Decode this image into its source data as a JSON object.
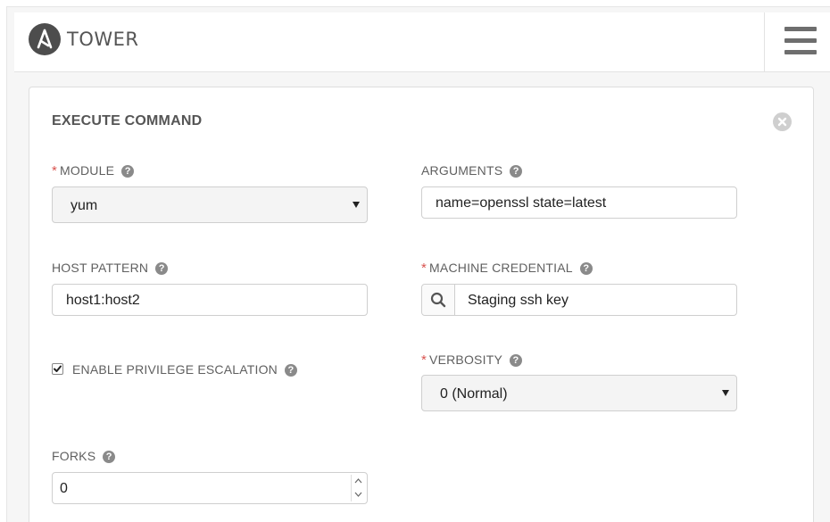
{
  "app": {
    "brand": "TOWER"
  },
  "panel": {
    "title": "EXECUTE COMMAND",
    "module": {
      "label": "MODULE",
      "required": "*",
      "value": "yum"
    },
    "arguments": {
      "label": "ARGUMENTS",
      "value": "name=openssl state=latest"
    },
    "host_pattern": {
      "label": "HOST PATTERN",
      "value": "host1:host2"
    },
    "machine_credential": {
      "label": "MACHINE CREDENTIAL",
      "required": "*",
      "value": "Staging ssh key"
    },
    "privilege_escalation": {
      "label": "ENABLE PRIVILEGE ESCALATION",
      "checked": true
    },
    "verbosity": {
      "label": "VERBOSITY",
      "required": "*",
      "value": "0 (Normal)"
    },
    "forks": {
      "label": "FORKS",
      "value": "0"
    }
  },
  "icons": {
    "help": "?",
    "logo": "ansible-logo-icon",
    "menu": "hamburger-menu-icon",
    "close": "close-circle-icon",
    "search": "search-icon"
  },
  "colors": {
    "required": "#d9534f",
    "logo_bg": "#4d4d4d",
    "menu": "#6e6e6e"
  }
}
